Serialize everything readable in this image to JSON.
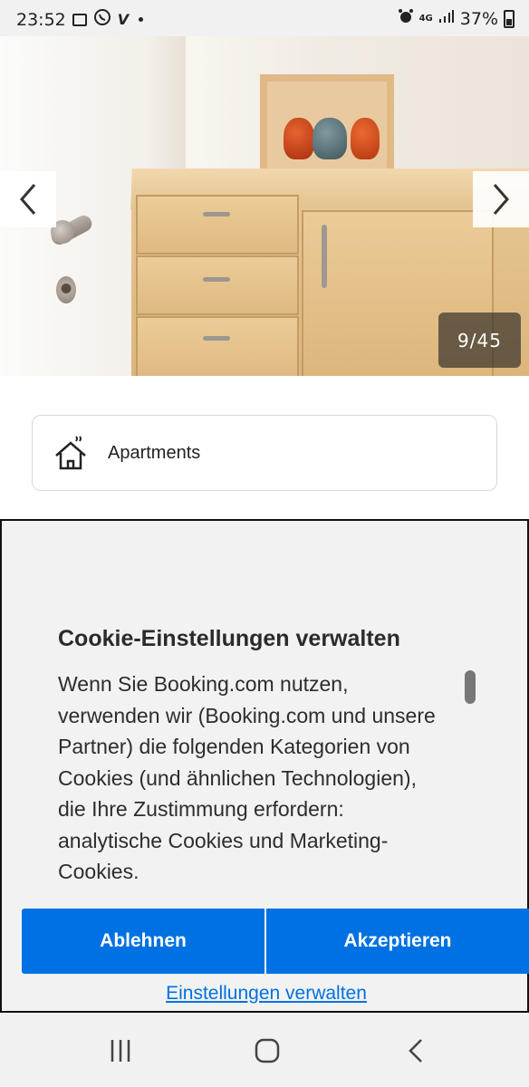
{
  "status_bar": {
    "time": "23:52",
    "left_icons": [
      "image-icon",
      "viber-icon",
      "v-app-icon",
      "notification-dot"
    ],
    "right_icons": [
      "alarm-icon",
      "4g-icon",
      "signal-icon",
      "battery-icon"
    ],
    "network": "4G",
    "battery": "37%"
  },
  "gallery": {
    "counter": "9/45",
    "current": 9,
    "total": 45,
    "prev_icon": "chevron-left-icon",
    "next_icon": "chevron-right-icon"
  },
  "property_type": {
    "icon": "house-icon",
    "label": "Apartments"
  },
  "cookie_dialog": {
    "title": "Cookie-Einstellungen verwalten",
    "text_lines": [
      "Wenn Sie Booking.com nutzen,",
      "verwenden wir (Booking.com und unsere",
      "Partner) die folgenden Kategorien von",
      "Cookies (und ähnlichen Technologien),",
      "die Ihre Zustimmung erfordern:",
      "analytische Cookies und Marketing-",
      "Cookies."
    ],
    "decline_label": "Ablehnen",
    "accept_label": "Akzeptieren",
    "manage_label": "Einstellungen verwalten",
    "accent_color": "#0071e2"
  },
  "nav_bar": {
    "recents_icon": "recents-icon",
    "home_icon": "home-icon",
    "back_icon": "back-icon"
  }
}
